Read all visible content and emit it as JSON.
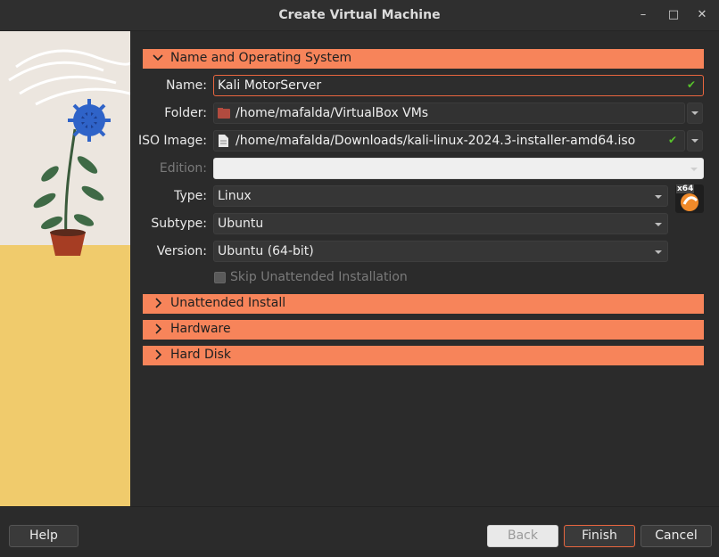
{
  "window": {
    "title": "Create Virtual Machine"
  },
  "sections": {
    "name_os": "Name and Operating System",
    "unattended": "Unattended Install",
    "hardware": "Hardware",
    "hard_disk": "Hard Disk"
  },
  "form": {
    "name_label": "Name:",
    "name_value": "Kali MotorServer",
    "folder_label": "Folder:",
    "folder_value": "/home/mafalda/VirtualBox VMs",
    "iso_label": "ISO Image:",
    "iso_value": "/home/mafalda/Downloads/kali-linux-2024.3-installer-amd64.iso",
    "edition_label": "Edition:",
    "edition_value": "",
    "type_label": "Type:",
    "type_value": "Linux",
    "subtype_label": "Subtype:",
    "subtype_value": "Ubuntu",
    "version_label": "Version:",
    "version_value": "Ubuntu (64-bit)",
    "skip_label": "Skip Unattended Installation",
    "os_badge": "x64"
  },
  "buttons": {
    "help": "Help",
    "back": "Back",
    "finish": "Finish",
    "cancel": "Cancel"
  },
  "colors": {
    "accent": "#f7845a",
    "valid": "#57c22b",
    "focus": "#e9663f"
  }
}
